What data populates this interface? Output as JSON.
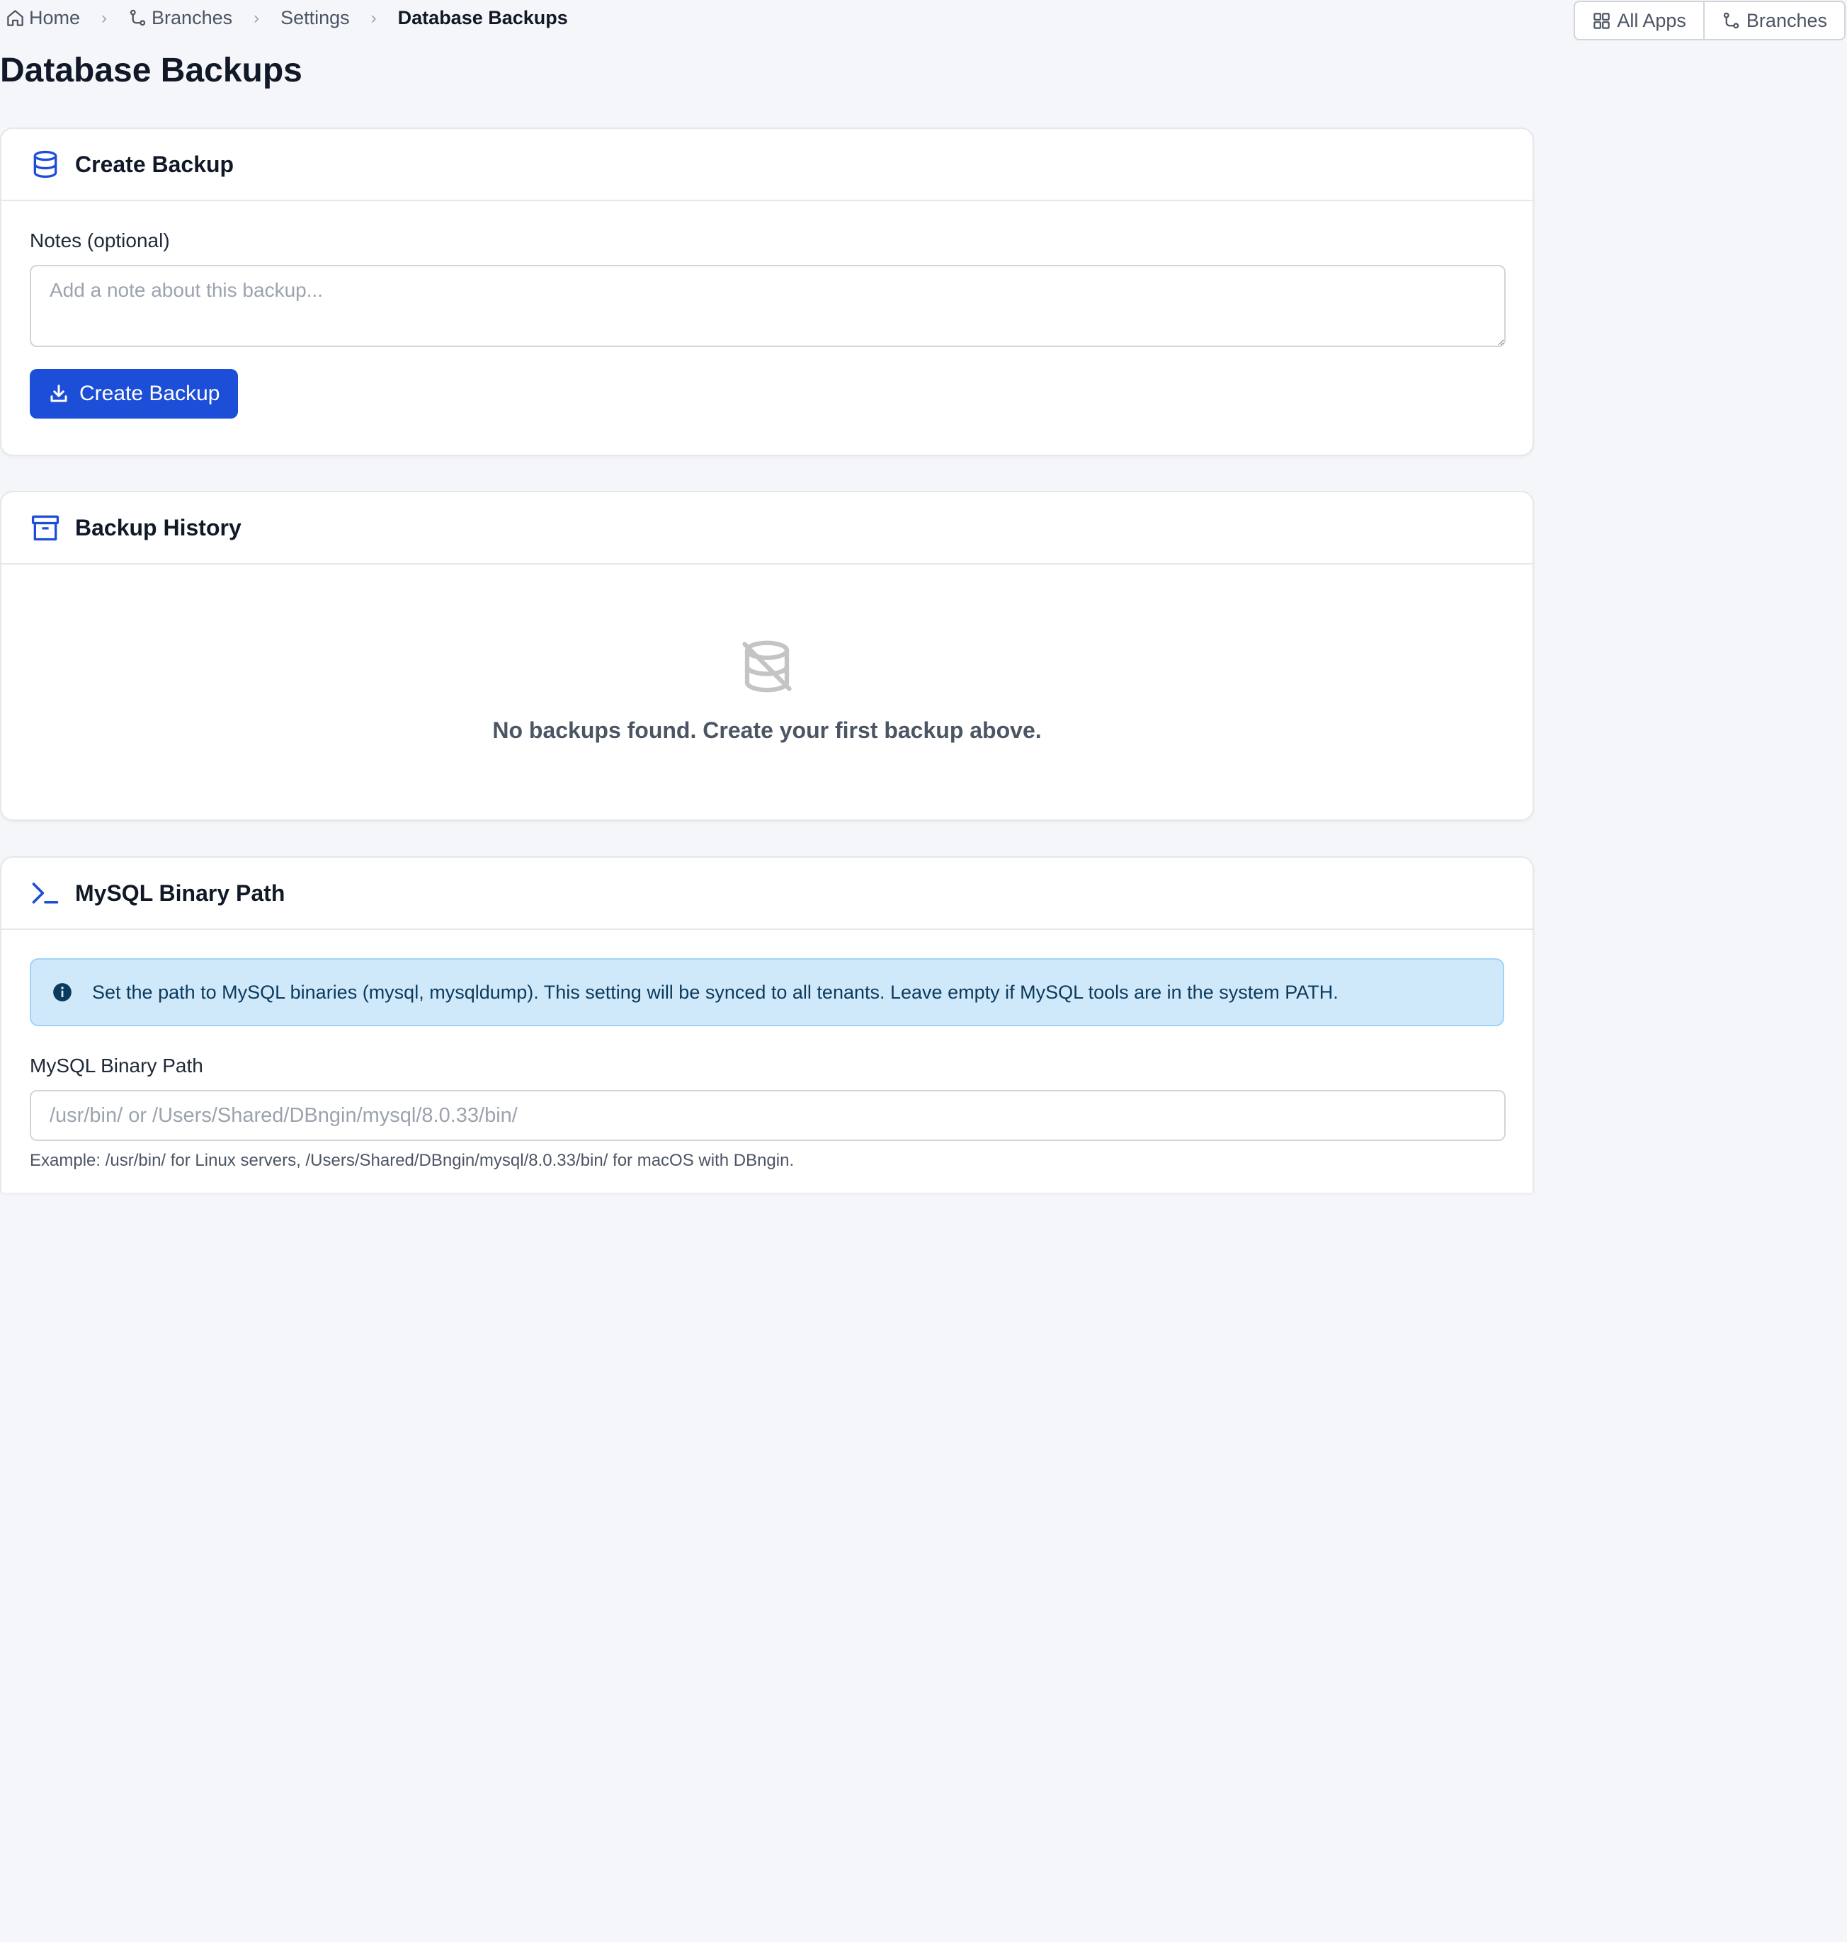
{
  "breadcrumb": {
    "home": "Home",
    "branches": "Branches",
    "settings": "Settings",
    "current": "Database Backups",
    "separator": "›"
  },
  "top_actions": {
    "all_apps": "All Apps",
    "branches": "Branches"
  },
  "page": {
    "title": "Database Backups"
  },
  "create_backup": {
    "title": "Create Backup",
    "notes_label": "Notes (optional)",
    "notes_placeholder": "Add a note about this backup...",
    "notes_value": "",
    "button_label": "Create Backup"
  },
  "backup_history": {
    "title": "Backup History",
    "empty_message": "No backups found. Create your first backup above."
  },
  "mysql_path": {
    "title": "MySQL Binary Path",
    "info_text": "Set the path to MySQL binaries (mysql, mysqldump). This setting will be synced to all tenants. Leave empty if MySQL tools are in the system PATH.",
    "field_label": "MySQL Binary Path",
    "placeholder": "/usr/bin/ or /Users/Shared/DBngin/mysql/8.0.33/bin/",
    "value": "",
    "help_text": "Example: /usr/bin/ for Linux servers, /Users/Shared/DBngin/mysql/8.0.33/bin/ for macOS with DBngin."
  },
  "colors": {
    "accent": "#1d4ed8",
    "background": "#f5f6fa",
    "info_bg": "#cfe9fb",
    "muted_icon": "#c4c4c4"
  },
  "icons": {
    "home": "home-icon",
    "branches": "git-branch-icon",
    "all_apps": "grid-icon",
    "create_backup": "database-icon",
    "download": "download-icon",
    "backup_history": "archive-icon",
    "empty": "database-slash-icon",
    "mysql_path": "terminal-icon",
    "info": "info-circle-icon"
  }
}
